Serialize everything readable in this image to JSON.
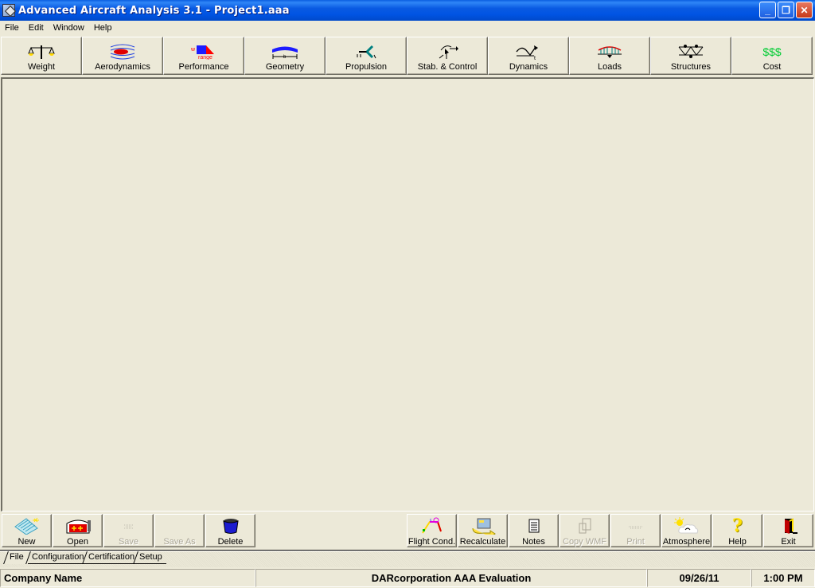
{
  "window": {
    "title": "Advanced Aircraft Analysis 3.1 - Project1.aaa",
    "controls": {
      "minimize": "_",
      "restore": "❐",
      "close": "✕"
    }
  },
  "menu": [
    "File",
    "Edit",
    "Window",
    "Help"
  ],
  "top_toolbar": [
    {
      "label": "Weight",
      "icon": "balance-scale-icon"
    },
    {
      "label": "Aerodynamics",
      "icon": "airflow-icon"
    },
    {
      "label": "Performance",
      "icon": "weight-range-icon",
      "icon_text_w": "w",
      "icon_text_range": "range"
    },
    {
      "label": "Geometry",
      "icon": "wing-span-icon",
      "icon_text": "b"
    },
    {
      "label": "Propulsion",
      "icon": "propeller-icon"
    },
    {
      "label": "Stab. & Control",
      "icon": "rotation-arrows-icon"
    },
    {
      "label": "Dynamics",
      "icon": "time-response-icon",
      "icon_text": "t"
    },
    {
      "label": "Loads",
      "icon": "distributed-load-icon"
    },
    {
      "label": "Structures",
      "icon": "truss-icon"
    },
    {
      "label": "Cost",
      "icon": "dollar-icon",
      "icon_text": "$$$"
    }
  ],
  "bottom_toolbar_left": [
    {
      "label": "New",
      "icon": "new-sheet-icon",
      "enabled": true
    },
    {
      "label": "Open",
      "icon": "open-hangar-icon",
      "enabled": true
    },
    {
      "label": "Save",
      "icon": "save-icon",
      "enabled": false
    },
    {
      "label": "Save As",
      "icon": "save-as-icon",
      "enabled": false
    },
    {
      "label": "Delete",
      "icon": "bucket-icon",
      "enabled": true
    }
  ],
  "bottom_toolbar_right": [
    {
      "label": "Flight Cond.",
      "icon": "flight-profile-icon",
      "enabled": true
    },
    {
      "label": "Recalculate",
      "icon": "recalculate-icon",
      "enabled": true
    },
    {
      "label": "Notes",
      "icon": "notepad-icon",
      "enabled": true
    },
    {
      "label": "Copy WMF",
      "icon": "clipboard-icon",
      "enabled": false
    },
    {
      "label": "Print",
      "icon": "printer-icon",
      "enabled": false
    },
    {
      "label": "Atmosphere",
      "icon": "sun-cloud-icon",
      "enabled": true
    },
    {
      "label": "Help",
      "icon": "question-mark-icon",
      "enabled": true,
      "icon_text": "?"
    },
    {
      "label": "Exit",
      "icon": "exit-door-icon",
      "enabled": true
    }
  ],
  "tabs": [
    {
      "label": "File",
      "active": true
    },
    {
      "label": "Configuration",
      "active": false
    },
    {
      "label": "Certification",
      "active": false
    },
    {
      "label": "Setup",
      "active": false
    }
  ],
  "status": {
    "company": "Company Name",
    "license": "DARcorporation AAA Evaluation",
    "date": "09/26/11",
    "time": "1:00 PM"
  },
  "colors": {
    "title_bar": "#0054e3",
    "face": "#ece9d8",
    "cost_green": "#00cc33"
  }
}
